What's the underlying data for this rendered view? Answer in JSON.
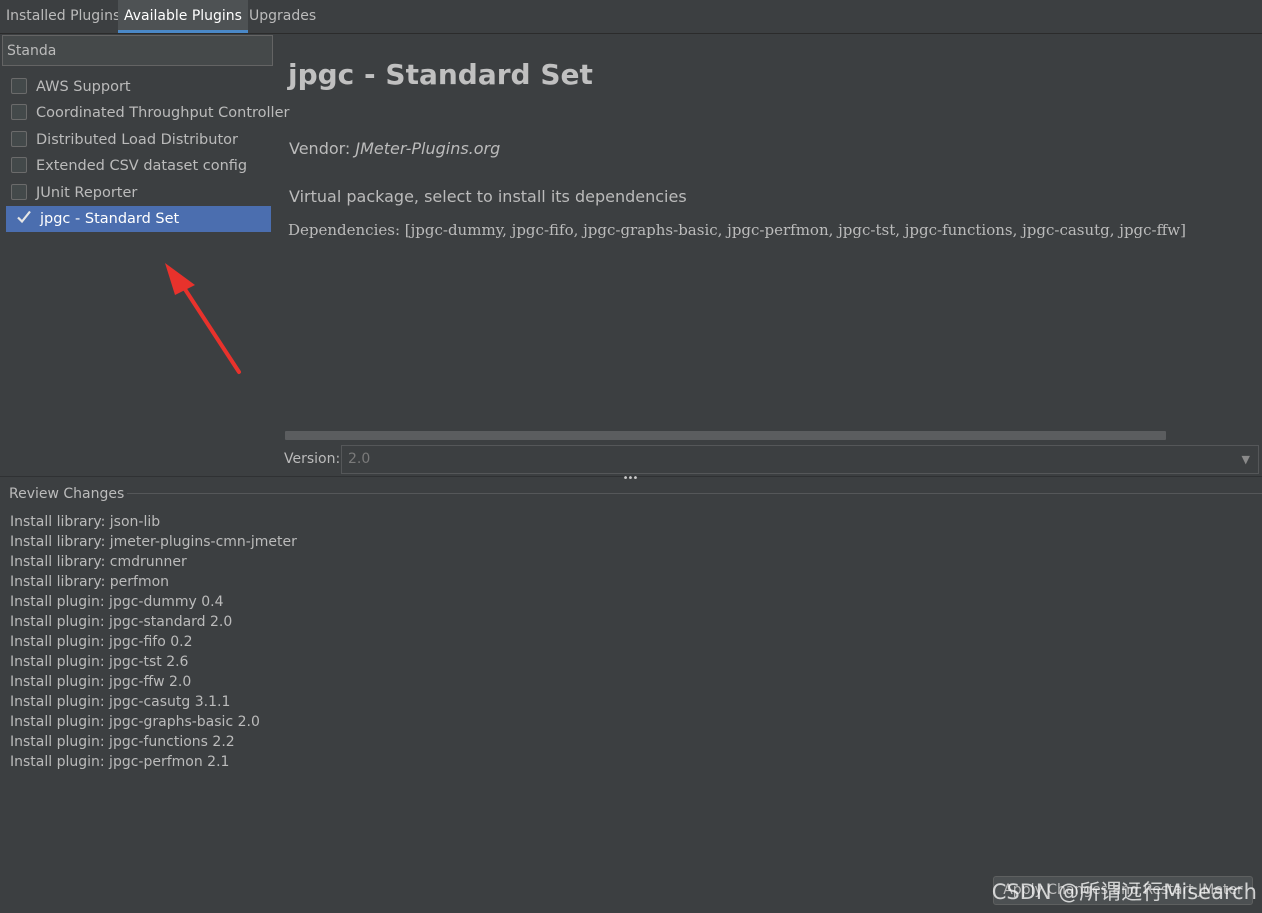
{
  "tabs": [
    {
      "label": "Installed Plugins",
      "active": false
    },
    {
      "label": "Available Plugins",
      "active": true
    },
    {
      "label": "Upgrades",
      "active": false
    }
  ],
  "search": {
    "value": "Standa"
  },
  "plugins": [
    {
      "label": "AWS Support",
      "checked": false,
      "selected": false
    },
    {
      "label": "Coordinated Throughput Controller",
      "checked": false,
      "selected": false
    },
    {
      "label": "Distributed Load Distributor",
      "checked": false,
      "selected": false
    },
    {
      "label": "Extended CSV dataset config",
      "checked": false,
      "selected": false
    },
    {
      "label": "JUnit Reporter",
      "checked": false,
      "selected": false
    },
    {
      "label": "jpgc - Standard Set",
      "checked": true,
      "selected": true
    }
  ],
  "detail": {
    "title": "jpgc - Standard Set",
    "vendor_label": "Vendor: ",
    "vendor_name": "JMeter-Plugins.org",
    "description": "Virtual package, select to install its dependencies",
    "dependencies": "Dependencies: [jpgc-dummy, jpgc-fifo, jpgc-graphs-basic, jpgc-perfmon, jpgc-tst, jpgc-functions, jpgc-casutg, jpgc-ffw]",
    "version_label": "Version:",
    "version_value": "2.0"
  },
  "review": {
    "title": "Review Changes",
    "items": [
      "Install library: json-lib",
      "Install library: jmeter-plugins-cmn-jmeter",
      "Install library: cmdrunner",
      "Install library: perfmon",
      "Install plugin: jpgc-dummy 0.4",
      "Install plugin: jpgc-standard 2.0",
      "Install plugin: jpgc-fifo 0.2",
      "Install plugin: jpgc-tst 2.6",
      "Install plugin: jpgc-ffw 2.0",
      "Install plugin: jpgc-casutg 3.1.1",
      "Install plugin: jpgc-graphs-basic 2.0",
      "Install plugin: jpgc-functions 2.2",
      "Install plugin: jpgc-perfmon 2.1"
    ]
  },
  "footer": {
    "apply_button": "Apply Changes and Restart JMeter",
    "watermark": "CSDN @所谓远行Misearch"
  },
  "colors": {
    "background": "#3c3f41",
    "selection": "#4b6eaf",
    "tab_underline": "#4a88c7",
    "annotation_arrow": "#e8322c"
  }
}
